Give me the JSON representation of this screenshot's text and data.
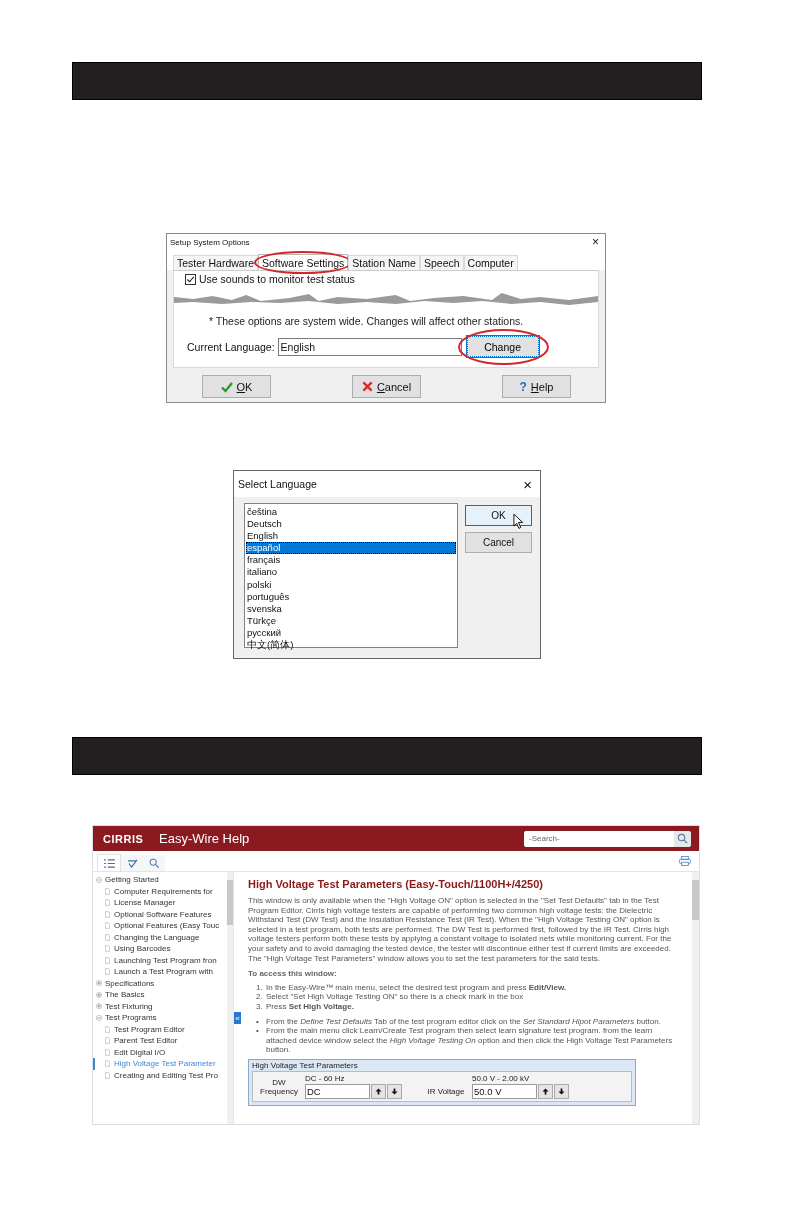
{
  "setup_dialog": {
    "title": "Setup System Options",
    "close": "×",
    "tabs": [
      {
        "label": "Tester Hardware",
        "selected": false,
        "circled": false
      },
      {
        "label": "Software Settings",
        "selected": true,
        "circled": true
      },
      {
        "label": "Station Name",
        "selected": false,
        "circled": false
      },
      {
        "label": "Speech",
        "selected": false,
        "circled": false
      },
      {
        "label": "Computer",
        "selected": false,
        "circled": false
      }
    ],
    "checkbox": {
      "label": "Use sounds to monitor test status",
      "checked": true
    },
    "note": "* These options are system wide. Changes will affect other stations.",
    "language_label": "Current Language:",
    "language_value": "English",
    "change_button": "Change",
    "buttons": [
      {
        "label": "OK",
        "kind": "ok"
      },
      {
        "label": "Cancel",
        "kind": "cancel"
      },
      {
        "label": "Help",
        "kind": "help",
        "glyph": "?"
      }
    ]
  },
  "language_dialog": {
    "title": "Select Language",
    "close": "×",
    "languages": [
      {
        "label": "čeština",
        "selected": false
      },
      {
        "label": "Deutsch",
        "selected": false
      },
      {
        "label": "English",
        "selected": false
      },
      {
        "label": "español",
        "selected": true
      },
      {
        "label": "français",
        "selected": false
      },
      {
        "label": "italiano",
        "selected": false
      },
      {
        "label": "polski",
        "selected": false
      },
      {
        "label": "português",
        "selected": false
      },
      {
        "label": "svenska",
        "selected": false
      },
      {
        "label": "Türkçe",
        "selected": false
      },
      {
        "label": "русский",
        "selected": false
      },
      {
        "label": "中文(简体)",
        "selected": false
      }
    ],
    "buttons": [
      {
        "label": "OK",
        "focused": true
      },
      {
        "label": "Cancel",
        "focused": false
      }
    ]
  },
  "help_window": {
    "logo": "CIRRIS",
    "title": "Easy-Wire Help",
    "search": {
      "placeholder": "-Search-"
    },
    "tree": [
      {
        "label": "Getting Started",
        "expanded": true,
        "selected": false,
        "children": [
          {
            "label": "Computer Requirements for",
            "selected": false
          },
          {
            "label": "License Manager",
            "selected": false
          },
          {
            "label": "Optional Software Features",
            "selected": false
          },
          {
            "label": "Optional Features (Easy Touc",
            "selected": false
          },
          {
            "label": "Changing the Language",
            "selected": false
          },
          {
            "label": "Using Barcodes",
            "selected": false
          },
          {
            "label": "Launching Test Program fron",
            "selected": false
          },
          {
            "label": "Launch a Test Program with",
            "selected": false
          }
        ]
      },
      {
        "label": "Specifications",
        "expanded": false,
        "selected": false
      },
      {
        "label": "The Basics",
        "expanded": false,
        "selected": false
      },
      {
        "label": "Test Fixturing",
        "expanded": false,
        "selected": false
      },
      {
        "label": "Test Programs",
        "expanded": true,
        "selected": false,
        "children": [
          {
            "label": "Test Program Editor",
            "selected": false
          },
          {
            "label": "Parent Test Editor",
            "selected": false
          },
          {
            "label": "Edit Digital I/O",
            "selected": false
          },
          {
            "label": "High Voltage Test Parameter",
            "selected": true
          },
          {
            "label": "Creating and Editing Test Pro",
            "selected": false
          }
        ]
      }
    ],
    "collapse_handle": "«",
    "article": {
      "title": "High Voltage Test Parameters (Easy-Touch/1100H+/4250)",
      "intro": "This window is only available when the \"High Voltage ON\" option is selected in the \"Set Test Defaults\" tab in the Test Program Editor. Cirris high voltage testers are capable of performing two common high voltage tests: the Dielectric Withstand Test (DW Test) and the Insulation Resistance Test (IR Test). When the \"High Voltage Testing ON\" option is selected in a test program, both tests are performed. The DW Test is performed first, followed by the IR Test. Cirris high voltage testers perform both these tests by applying a constant voltage to isolated nets while monitoring current. For the your safety and to avoid damaging the tested device, the tester will discontinue either test if current limits are exceeded. The \"High Voltage Test Parameters\" window allows you to set the test parameters for the said tests.",
      "access_heading": "To access this window:",
      "steps": [
        {
          "number": "1.",
          "text": "In the Easy-Wire™ main menu, select the desired test program and press **Edit/View.**"
        },
        {
          "number": "2.",
          "text": "Select \"Set High Voltage Testing ON\" so there is a check mark in the box"
        },
        {
          "number": "3.",
          "text": "Press **Set High Voltage.**"
        }
      ],
      "bullets": [
        {
          "mark": "•",
          "text": "From the *Define Test Defaults* Tab of the test program editor click on the *Set Standard Hipot Parameters* button."
        },
        {
          "mark": "•",
          "text": "From the main menu click Learn/Create Test program then select learn signature test program. from the learn attached device window select the *High Voltage Testing On* option and then click the High Voltage Test Parameters button."
        }
      ],
      "panel": {
        "title": "High Voltage Test Parameters",
        "fields": [
          {
            "label": "DW Frequency",
            "range": "DC - 60 Hz",
            "value": "DC"
          },
          {
            "label": "IR Voltage",
            "range": "50.0 V - 2.00 kV",
            "value": "50.0 V"
          }
        ]
      }
    }
  }
}
